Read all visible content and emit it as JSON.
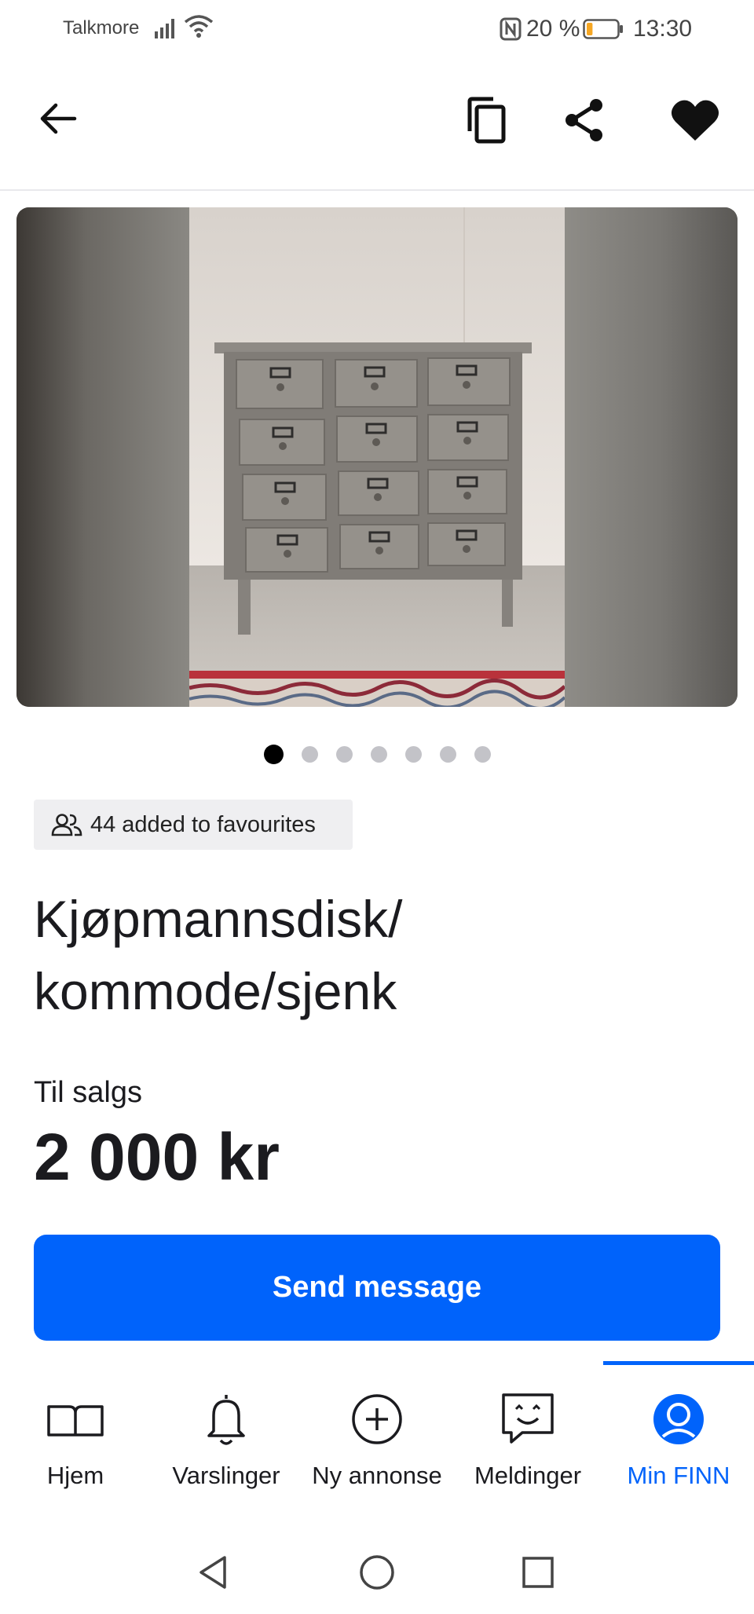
{
  "status_bar": {
    "carrier": "Talkmore",
    "battery_percent": "20 %",
    "battery_level": 0.2,
    "time": "13:30"
  },
  "app_bar": {
    "back_icon": "arrow-left-icon",
    "copy_icon": "copy-icon",
    "share_icon": "share-icon",
    "favourite_icon": "heart-filled-icon"
  },
  "gallery": {
    "image_count": 7,
    "active_index": 0
  },
  "favourites": {
    "icon": "users-icon",
    "count": "44",
    "label": "added to favourites"
  },
  "listing": {
    "title": "Kjøpmannsdisk/ kommode/sjenk",
    "sale_label": "Til salgs",
    "price": "2 000 kr"
  },
  "actions": {
    "send_message": "Send message"
  },
  "bottom_nav": {
    "items": [
      {
        "label": "Hjem",
        "icon": "book-icon"
      },
      {
        "label": "Varslinger",
        "icon": "bell-icon"
      },
      {
        "label": "Ny annonse",
        "icon": "plus-circle-icon"
      },
      {
        "label": "Meldinger",
        "icon": "chat-icon"
      },
      {
        "label": "Min FINN",
        "icon": "profile-icon"
      }
    ],
    "active_index": 4
  },
  "colors": {
    "accent": "#0063fb",
    "text": "#1b1b1f",
    "chip_bg": "#efeff1",
    "dot_inactive": "#c3c3c8"
  }
}
